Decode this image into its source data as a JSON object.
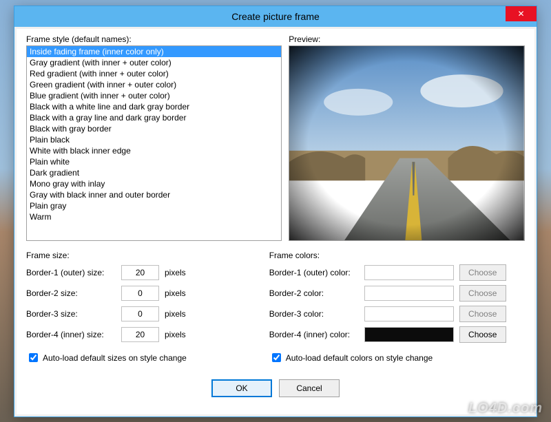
{
  "window": {
    "title": "Create picture frame"
  },
  "frameStyle": {
    "label": "Frame style (default names):",
    "selectedIndex": 0,
    "items": [
      "Inside fading frame (inner color only)",
      "Gray gradient (with inner + outer color)",
      "Red gradient (with inner + outer color)",
      "Green gradient (with inner + outer color)",
      "Blue gradient (with inner + outer color)",
      "Black with a white line and dark gray border",
      "Black with a gray line and dark gray border",
      "Black with gray border",
      "Plain black",
      "White with black inner edge",
      "Plain white",
      "Dark gradient",
      "Mono gray with inlay",
      "Gray with black inner and outer border",
      "Plain gray",
      "Warm"
    ]
  },
  "preview": {
    "label": "Preview:"
  },
  "frameSize": {
    "label": "Frame size:",
    "rows": [
      {
        "label": "Border-1 (outer) size:",
        "value": "20",
        "unit": "pixels"
      },
      {
        "label": "Border-2 size:",
        "value": "0",
        "unit": "pixels"
      },
      {
        "label": "Border-3 size:",
        "value": "0",
        "unit": "pixels"
      },
      {
        "label": "Border-4 (inner) size:",
        "value": "20",
        "unit": "pixels"
      }
    ],
    "autoload": "Auto-load default sizes on style change",
    "autoloadChecked": true
  },
  "frameColors": {
    "label": "Frame colors:",
    "rows": [
      {
        "label": "Border-1 (outer) color:",
        "swatch": "#ffffff",
        "choose": "Choose",
        "enabled": false
      },
      {
        "label": "Border-2 color:",
        "swatch": "#ffffff",
        "choose": "Choose",
        "enabled": false
      },
      {
        "label": "Border-3 color:",
        "swatch": "#ffffff",
        "choose": "Choose",
        "enabled": false
      },
      {
        "label": "Border-4 (inner) color:",
        "swatch": "#0c0c0c",
        "choose": "Choose",
        "enabled": true
      }
    ],
    "autoload": "Auto-load default colors on style change",
    "autoloadChecked": true
  },
  "buttons": {
    "ok": "OK",
    "cancel": "Cancel"
  },
  "watermark": "LO4D.com"
}
